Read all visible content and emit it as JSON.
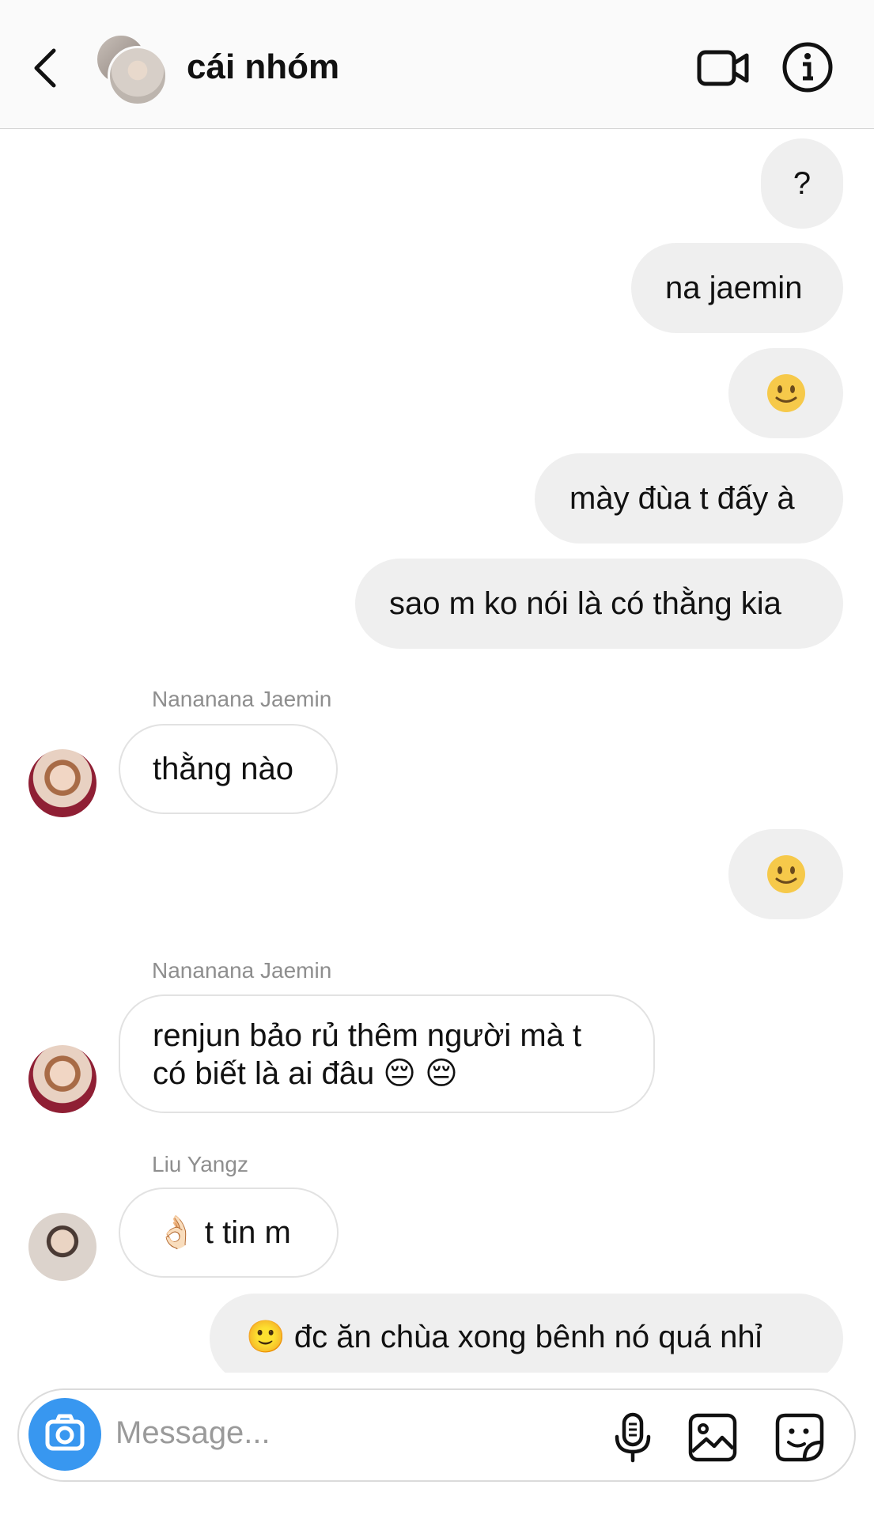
{
  "header": {
    "title": "cái nhóm",
    "back_icon": "chevron-left-icon",
    "video_icon": "video-camera-icon",
    "info_icon": "info-circle-icon"
  },
  "messages": [
    {
      "side": "me",
      "text": "?"
    },
    {
      "side": "me",
      "text": "na jaemin"
    },
    {
      "side": "me",
      "text": "🙂"
    },
    {
      "side": "me",
      "text": "mày đùa t đấy à"
    },
    {
      "side": "me",
      "text": "sao m ko nói là có thằng kia"
    },
    {
      "side": "them",
      "sender": "Nananana Jaemin",
      "text": "thằng nào"
    },
    {
      "side": "me",
      "text": "🙂"
    },
    {
      "side": "them",
      "sender": "Nananana Jaemin",
      "text_line1": "renjun bảo rủ thêm người mà t",
      "text_line2": "có biết là ai đâu 😔 😔"
    },
    {
      "side": "them",
      "sender": "Liu Yangz",
      "text": "👌🏻 t tin m"
    },
    {
      "side": "me",
      "text": "🙂 đc ăn chùa xong bênh nó quá nhỉ"
    }
  ],
  "composer": {
    "placeholder": "Message...",
    "camera_icon": "camera-icon",
    "mic_icon": "microphone-icon",
    "gallery_icon": "image-icon",
    "sticker_icon": "sticker-icon"
  },
  "colors": {
    "my_bubble": "#efefef",
    "their_border": "#e2e2e2",
    "camera_button": "#3897f0",
    "sender_label": "#8e8e8e"
  }
}
